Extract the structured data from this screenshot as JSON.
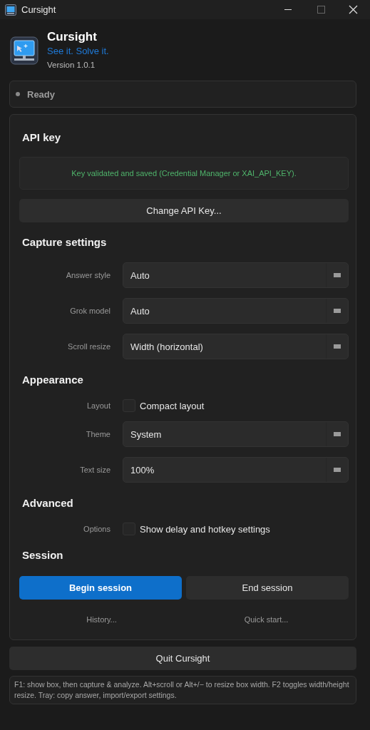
{
  "window": {
    "title": "Cursight"
  },
  "header": {
    "app_name": "Cursight",
    "tagline": "See it. Solve it.",
    "version": "Version 1.0.1"
  },
  "status": {
    "text": "Ready"
  },
  "api_key": {
    "heading": "API key",
    "message": "Key validated and saved (Credential Manager or XAI_API_KEY).",
    "button": "Change API Key..."
  },
  "sections": [
    {
      "heading": "Capture settings",
      "rows": [
        {
          "kind": "combo",
          "label": "Answer style",
          "value": "Auto"
        },
        {
          "kind": "combo",
          "label": "Grok model",
          "value": "Auto"
        },
        {
          "kind": "combo",
          "label": "Scroll resize",
          "value": "Width (horizontal)"
        }
      ]
    },
    {
      "heading": "Appearance",
      "rows": [
        {
          "kind": "checkbox",
          "label": "Layout",
          "text": "Compact layout",
          "checked": false
        },
        {
          "kind": "combo",
          "label": "Theme",
          "value": "System"
        },
        {
          "kind": "combo",
          "label": "Text size",
          "value": "100%"
        }
      ]
    },
    {
      "heading": "Advanced",
      "rows": [
        {
          "kind": "checkbox",
          "label": "Options",
          "text": "Show delay and hotkey settings",
          "checked": false
        }
      ]
    }
  ],
  "session": {
    "heading": "Session",
    "buttons": [
      {
        "label": "Begin session",
        "primary": true
      },
      {
        "label": "End session",
        "primary": false
      }
    ],
    "links": [
      "History...",
      "Quick start..."
    ]
  },
  "quit_button": "Quit Cursight",
  "footer": "F1: show box, then capture & analyze. Alt+scroll or Alt+/− to resize box width. F2 toggles width/height resize. Tray: copy answer, import/export settings."
}
